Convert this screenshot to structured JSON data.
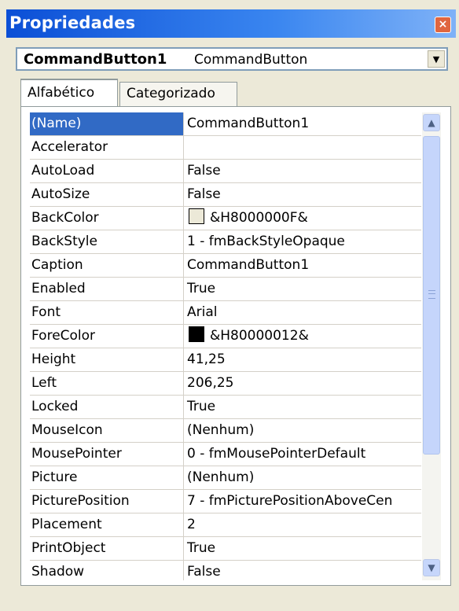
{
  "window": {
    "title": "Propriedades",
    "close_glyph": "×"
  },
  "object_selector": {
    "name": "CommandButton1",
    "type": "CommandButton"
  },
  "tabs": [
    {
      "label": "Alfabético",
      "active": true
    },
    {
      "label": "Categorizado",
      "active": false
    }
  ],
  "properties": [
    {
      "name": "(Name)",
      "value": "CommandButton1",
      "selected": true
    },
    {
      "name": "Accelerator",
      "value": ""
    },
    {
      "name": "AutoLoad",
      "value": "False"
    },
    {
      "name": "AutoSize",
      "value": "False"
    },
    {
      "name": "BackColor",
      "value": "&H8000000F&",
      "swatch": "#ece9d8"
    },
    {
      "name": "BackStyle",
      "value": "1 - fmBackStyleOpaque"
    },
    {
      "name": "Caption",
      "value": "CommandButton1"
    },
    {
      "name": "Enabled",
      "value": "True"
    },
    {
      "name": "Font",
      "value": "Arial"
    },
    {
      "name": "ForeColor",
      "value": "&H80000012&",
      "swatch": "#000000"
    },
    {
      "name": "Height",
      "value": "41,25"
    },
    {
      "name": "Left",
      "value": "206,25"
    },
    {
      "name": "Locked",
      "value": "True"
    },
    {
      "name": "MouseIcon",
      "value": "(Nenhum)"
    },
    {
      "name": "MousePointer",
      "value": "0 - fmMousePointerDefault"
    },
    {
      "name": "Picture",
      "value": "(Nenhum)"
    },
    {
      "name": "PicturePosition",
      "value": "7 - fmPicturePositionAboveCen"
    },
    {
      "name": "Placement",
      "value": "2"
    },
    {
      "name": "PrintObject",
      "value": "True"
    },
    {
      "name": "Shadow",
      "value": "False"
    }
  ],
  "colors": {
    "title_start": "#0b4fd6",
    "selection": "#316ac5",
    "face": "#ece9d8"
  }
}
